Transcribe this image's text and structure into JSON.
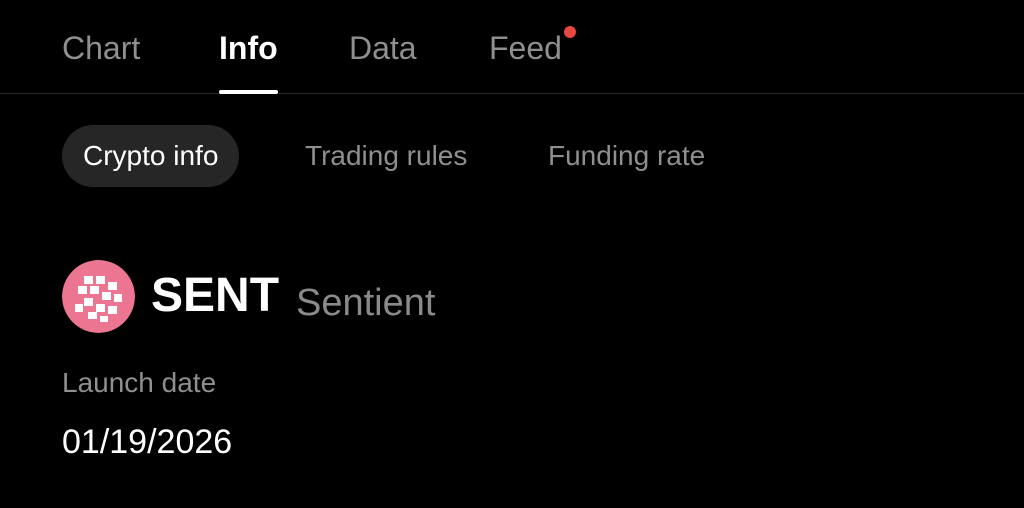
{
  "top_tabs": [
    {
      "label": "Chart"
    },
    {
      "label": "Info"
    },
    {
      "label": "Data"
    },
    {
      "label": "Feed"
    }
  ],
  "sub_tabs": [
    {
      "label": "Crypto info"
    },
    {
      "label": "Trading rules"
    },
    {
      "label": "Funding rate"
    }
  ],
  "token": {
    "symbol": "SENT",
    "name": "Sentient",
    "logo_icon": "sentient-logo-icon",
    "logo_color": "#ec7591"
  },
  "info": {
    "launch_date_label": "Launch date",
    "launch_date_value": "01/19/2026"
  },
  "colors": {
    "background": "#000000",
    "notification_dot": "#e5483f",
    "active_subtab_bg": "#262626"
  }
}
